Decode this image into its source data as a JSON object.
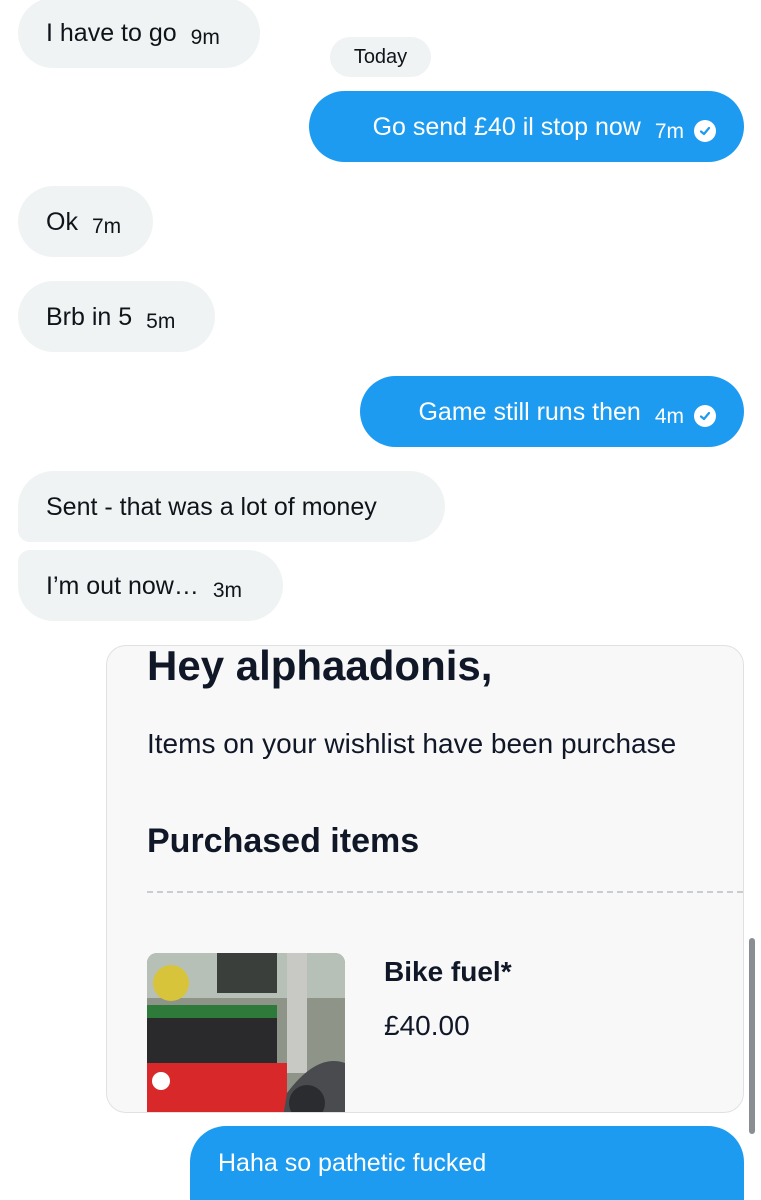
{
  "messages": [
    {
      "text": "I have to go",
      "time": "9m"
    },
    {
      "text": "Go send £40 il stop now",
      "time": "7m"
    },
    {
      "text": "Ok",
      "time": "7m"
    },
    {
      "text": "Brb in 5",
      "time": "5m"
    },
    {
      "text": "Game still runs then",
      "time": "4m"
    },
    {
      "text": "Sent - that was a lot of money"
    },
    {
      "text": "I’m out now…",
      "time": "3m"
    },
    {
      "text": "Haha so pathetic fucked"
    }
  ],
  "divider": {
    "label": "Today"
  },
  "card": {
    "greeting": "Hey alphaadonis,",
    "message": "Items on your wishlist have been purchase",
    "heading": "Purchased items",
    "item": {
      "name": "Bike fuel*",
      "price": "£40.00"
    }
  },
  "colors": {
    "outgoing": "#1d9bf0",
    "incoming": "#eff3f4"
  },
  "icons": {
    "sent_status": "check-circle-icon"
  }
}
